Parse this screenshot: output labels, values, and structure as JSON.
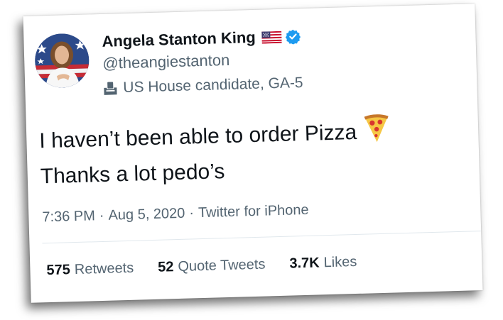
{
  "tweet": {
    "author": {
      "display_name": "Angela Stanton King",
      "handle": "@theangiestanton",
      "verified": true,
      "flag_icon": "us-flag-icon",
      "verified_icon": "verified-badge-icon",
      "avatar_icon": "profile-avatar"
    },
    "label": {
      "icon": "ballot-box-icon",
      "text": "US House candidate, GA-5"
    },
    "text_lines": [
      "I haven’t been able to order Pizza",
      "Thanks a lot pedo’s"
    ],
    "emoji_icon": "pizza-emoji-icon",
    "meta": {
      "time": "7:36 PM",
      "separator": "·",
      "date": "Aug 5, 2020",
      "source": "Twitter for iPhone"
    },
    "stats": [
      {
        "count": "575",
        "label": "Retweets"
      },
      {
        "count": "52",
        "label": "Quote Tweets"
      },
      {
        "count": "3.7K",
        "label": "Likes"
      }
    ]
  },
  "colors": {
    "text_primary": "#0f1419",
    "text_secondary": "#536471",
    "verified_blue": "#1d9bf0",
    "divider": "#e1e8ed"
  }
}
